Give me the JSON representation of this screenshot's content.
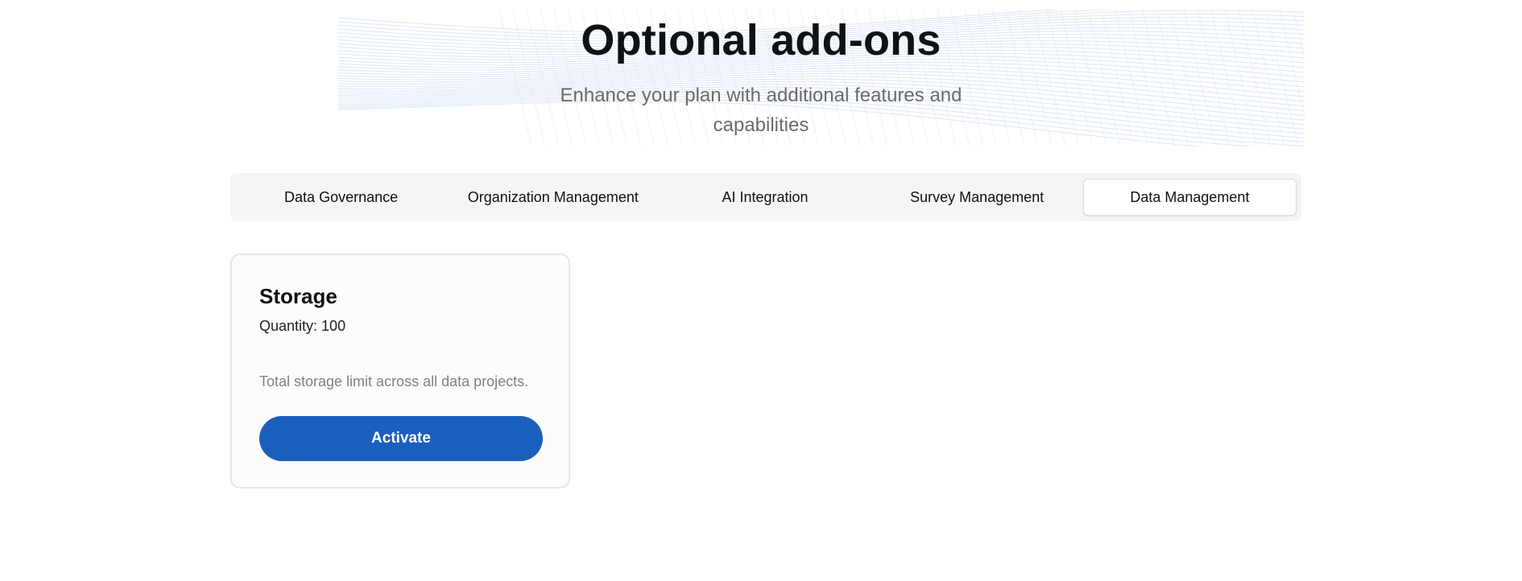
{
  "header": {
    "title": "Optional add-ons",
    "subtitle": "Enhance your plan with additional features and capabilities"
  },
  "tabs": [
    {
      "label": "Data Governance",
      "active": false
    },
    {
      "label": "Organization Management",
      "active": false
    },
    {
      "label": "AI Integration",
      "active": false
    },
    {
      "label": "Survey Management",
      "active": false
    },
    {
      "label": "Data Management",
      "active": true
    }
  ],
  "addons": [
    {
      "name": "Storage",
      "quantity_label": "Quantity:",
      "quantity_value": "100",
      "description": "Total storage limit across all data projects.",
      "action_label": "Activate"
    }
  ],
  "colors": {
    "accent": "#1b5fbe",
    "tab_bar_bg": "#f5f5f5",
    "card_bg": "#fcfcfc",
    "wave": "#9dbbe8"
  }
}
